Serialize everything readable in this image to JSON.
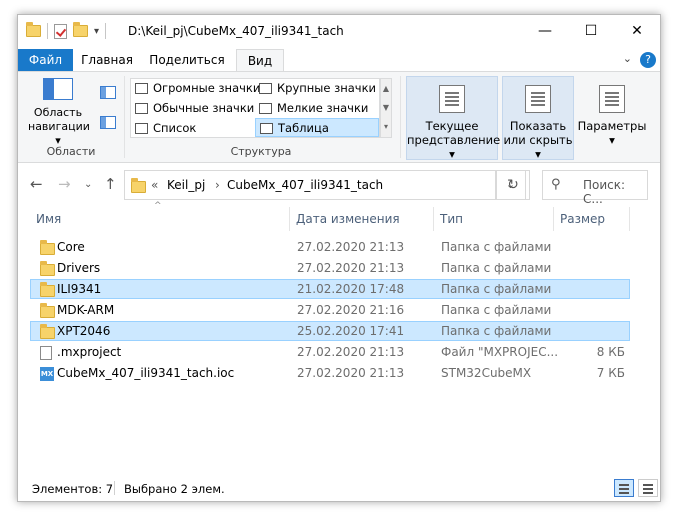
{
  "window": {
    "title": "D:\\Keil_pj\\CubeMx_407_ili9341_tach",
    "minimize_glyph": "—",
    "maximize_glyph": "☐",
    "close_glyph": "✕"
  },
  "tabs": {
    "file": "Файл",
    "home": "Главная",
    "share": "Поделиться",
    "view": "Вид",
    "help": "?"
  },
  "ribbon": {
    "areas": {
      "nav_pane_line1": "Область",
      "nav_pane_line2": "навигации ▾",
      "label": "Области"
    },
    "layout": {
      "huge_icons": "Огромные значки",
      "large_icons": "Крупные значки",
      "medium_icons": "Обычные значки",
      "small_icons": "Мелкие значки",
      "list": "Список",
      "details": "Таблица",
      "label": "Структура"
    },
    "current_view_line1": "Текущее",
    "current_view_line2": "представление ▾",
    "show_hide_line1": "Показать",
    "show_hide_line2": "или скрыть ▾",
    "options_line1": "Параметры",
    "options_line2": "▾"
  },
  "address": {
    "crumb_prefix": "«",
    "crumb1": "Keil_pj",
    "crumb_sep": "›",
    "crumb2": "CubeMx_407_ili9341_tach",
    "search_placeholder": "Поиск: С..."
  },
  "columns": {
    "name": "Имя",
    "date": "Дата изменения",
    "type": "Тип",
    "size": "Размер"
  },
  "files": [
    {
      "name": "Core",
      "date": "27.02.2020 21:13",
      "type": "Папка с файлами",
      "size": "",
      "icon": "folder-icon",
      "selected": false
    },
    {
      "name": "Drivers",
      "date": "27.02.2020 21:13",
      "type": "Папка с файлами",
      "size": "",
      "icon": "folder-icon",
      "selected": false
    },
    {
      "name": "ILI9341",
      "date": "21.02.2020 17:48",
      "type": "Папка с файлами",
      "size": "",
      "icon": "folder-icon",
      "selected": true
    },
    {
      "name": "MDK-ARM",
      "date": "27.02.2020 21:16",
      "type": "Папка с файлами",
      "size": "",
      "icon": "folder-icon",
      "selected": false
    },
    {
      "name": "XPT2046",
      "date": "25.02.2020 17:41",
      "type": "Папка с файлами",
      "size": "",
      "icon": "folder-icon",
      "selected": true
    },
    {
      "name": ".mxproject",
      "date": "27.02.2020 21:13",
      "type": "Файл \"MXPROJEC...",
      "size": "8 КБ",
      "icon": "file-icon",
      "selected": false
    },
    {
      "name": "CubeMx_407_ili9341_tach.ioc",
      "date": "27.02.2020 21:13",
      "type": "STM32CubeMX",
      "size": "7 КБ",
      "icon": "mx-icon",
      "selected": false
    }
  ],
  "mx_icon_text": "MX",
  "status": {
    "count": "Элементов: 7",
    "selected": "Выбрано 2 элем."
  },
  "colors": {
    "accent": "#1979ca",
    "selection": "#cce8ff",
    "folder": "#f7d36a"
  }
}
